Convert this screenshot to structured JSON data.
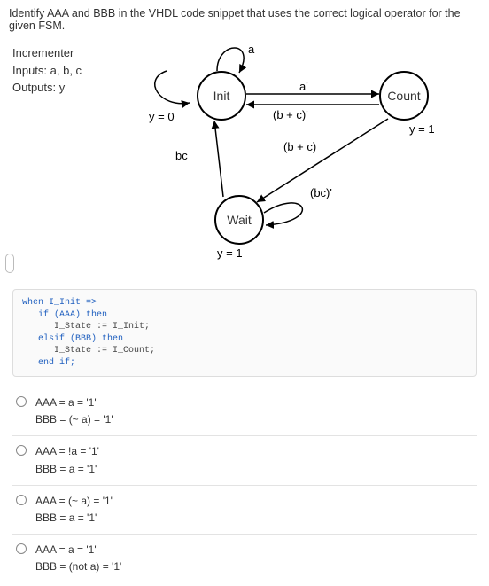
{
  "question": "Identify AAA and BBB in the VHDL code snippet that uses the correct logical operator for the given FSM.",
  "info": {
    "title": "Incrementer",
    "inputs_label": "Inputs: a, b, c",
    "outputs_label": "Outputs: y"
  },
  "fsm": {
    "states": {
      "init": "Init",
      "count": "Count",
      "wait": "Wait"
    },
    "edges": {
      "init_self": "a",
      "init_to_count": "a'",
      "count_to_init": "(b + c)'",
      "count_to_wait": "(b + c)",
      "wait_self": "(bc)'",
      "wait_to_init": "bc"
    },
    "outputs": {
      "init": "y = 0",
      "count": "y = 1",
      "wait": "y = 1"
    }
  },
  "code": {
    "l1": "when I_Init =>",
    "l2": "   if (AAA) then",
    "l3": "      I_State := I_Init;",
    "l4": "   elsif (BBB) then",
    "l5": "      I_State := I_Count;",
    "l6": "   end if;"
  },
  "options": [
    {
      "aaa": "AAA = a = '1'",
      "bbb": "BBB = (~ a) = '1'"
    },
    {
      "aaa": "AAA = !a = '1'",
      "bbb": "BBB = a = '1'"
    },
    {
      "aaa": "AAA = (~ a) = '1'",
      "bbb": "BBB = a = '1'"
    },
    {
      "aaa": "AAA = a = '1'",
      "bbb": "BBB = (not a) = '1'"
    }
  ]
}
